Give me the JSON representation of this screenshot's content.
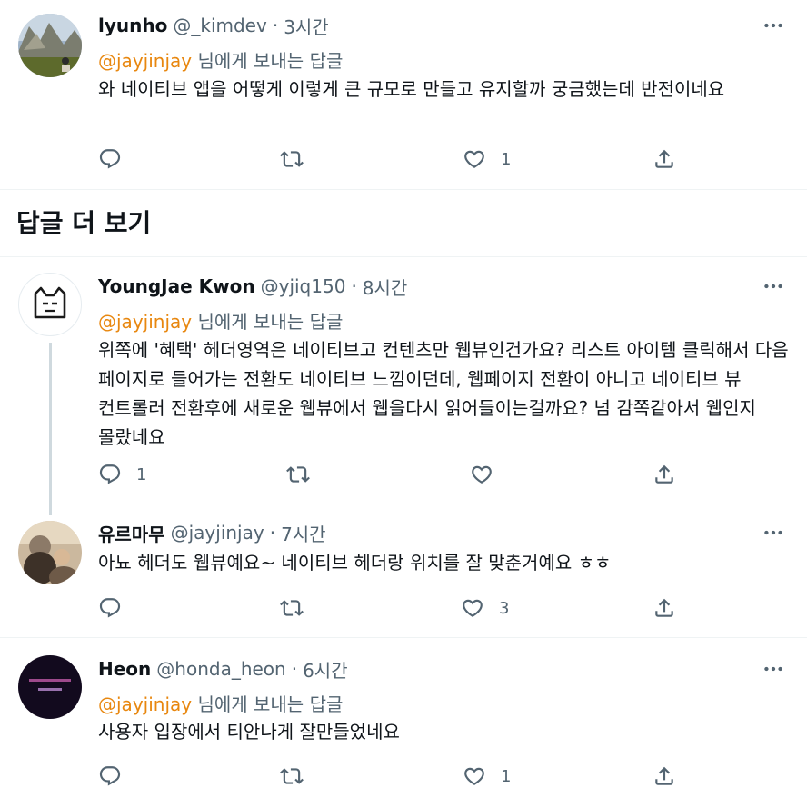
{
  "tweets": [
    {
      "name": "lyunho",
      "handle": "@_kimdev",
      "time": "3시간",
      "reply_mention": "@jayjinjay",
      "reply_suffix": " 님에게 보내는 답글",
      "text": "와 네이티브 앱을 어떻게 이렇게 큰 규모로 만들고 유지할까 궁금했는데 반전이네요",
      "reply_count": "",
      "retweet_count": "",
      "like_count": "1"
    },
    {
      "name": "YoungJae Kwon",
      "handle": "@yjiq150",
      "time": "8시간",
      "reply_mention": "@jayjinjay",
      "reply_suffix": " 님에게 보내는 답글",
      "text": "위쪽에 '혜택' 헤더영역은 네이티브고 컨텐츠만 웹뷰인건가요? 리스트 아이템 클릭해서 다음 페이지로 들어가는 전환도 네이티브 느낌이던데, 웹페이지 전환이 아니고 네이티브 뷰 컨트롤러 전환후에 새로운 웹뷰에서 웹을다시 읽어들이는걸까요? 넘 감쪽같아서 웹인지 몰랐네요",
      "reply_count": "1",
      "retweet_count": "",
      "like_count": ""
    },
    {
      "name": "유르마무",
      "handle": "@jayjinjay",
      "time": "7시간",
      "text": "아뇨 헤더도 웹뷰예요~ 네이티브 헤더랑 위치를 잘 맞춘거예요 ㅎㅎ",
      "reply_count": "",
      "retweet_count": "",
      "like_count": "3"
    },
    {
      "name": "Heon",
      "handle": "@honda_heon",
      "time": "6시간",
      "reply_mention": "@jayjinjay",
      "reply_suffix": " 님에게 보내는 답글",
      "text": "사용자 입장에서 티안나게 잘만들었네요",
      "reply_count": "",
      "retweet_count": "",
      "like_count": "1"
    }
  ],
  "section_title": "답글 더 보기",
  "separator": "·",
  "icons": {
    "reply": "reply-icon",
    "retweet": "retweet-icon",
    "like": "heart-icon",
    "share": "share-icon",
    "more": "more-dots-icon"
  },
  "colors": {
    "mention": "#e8870f",
    "secondary_text": "#536471",
    "divider": "#eff3f4"
  }
}
